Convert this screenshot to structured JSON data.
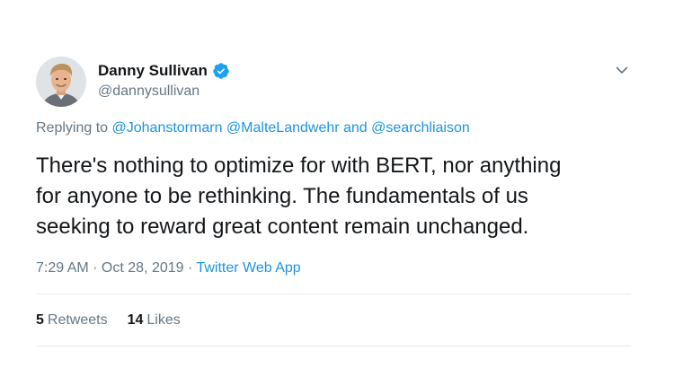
{
  "author": {
    "display_name": "Danny Sullivan",
    "handle": "@dannysullivan",
    "verified_icon": "verified-badge-icon",
    "avatar_alt": "avatar"
  },
  "reply": {
    "prefix": "Replying to ",
    "mention_1": "@Johanstormarn",
    "mention_2": "@MalteLandwehr",
    "conjunction": " and ",
    "mention_3": "@searchliaison"
  },
  "tweet": {
    "lines": [
      "There's nothing to optimize for with BERT, nor anything",
      "for anyone to be rethinking. The fundamentals of us",
      "seeking to reward great content remain unchanged."
    ]
  },
  "meta": {
    "time": "7:29 AM",
    "separator": " · ",
    "date": "Oct 28, 2019",
    "source": "Twitter Web App"
  },
  "stats": {
    "retweets_count": "5",
    "retweets_label": "Retweets",
    "likes_count": "14",
    "likes_label": "Likes"
  },
  "colors": {
    "link": "#1b95e0",
    "secondary_text": "#657786",
    "primary_text": "#14171a",
    "divider": "#e6ecf0",
    "verified": "#1da1f2"
  },
  "icons": {
    "menu": "chevron-down-icon"
  }
}
